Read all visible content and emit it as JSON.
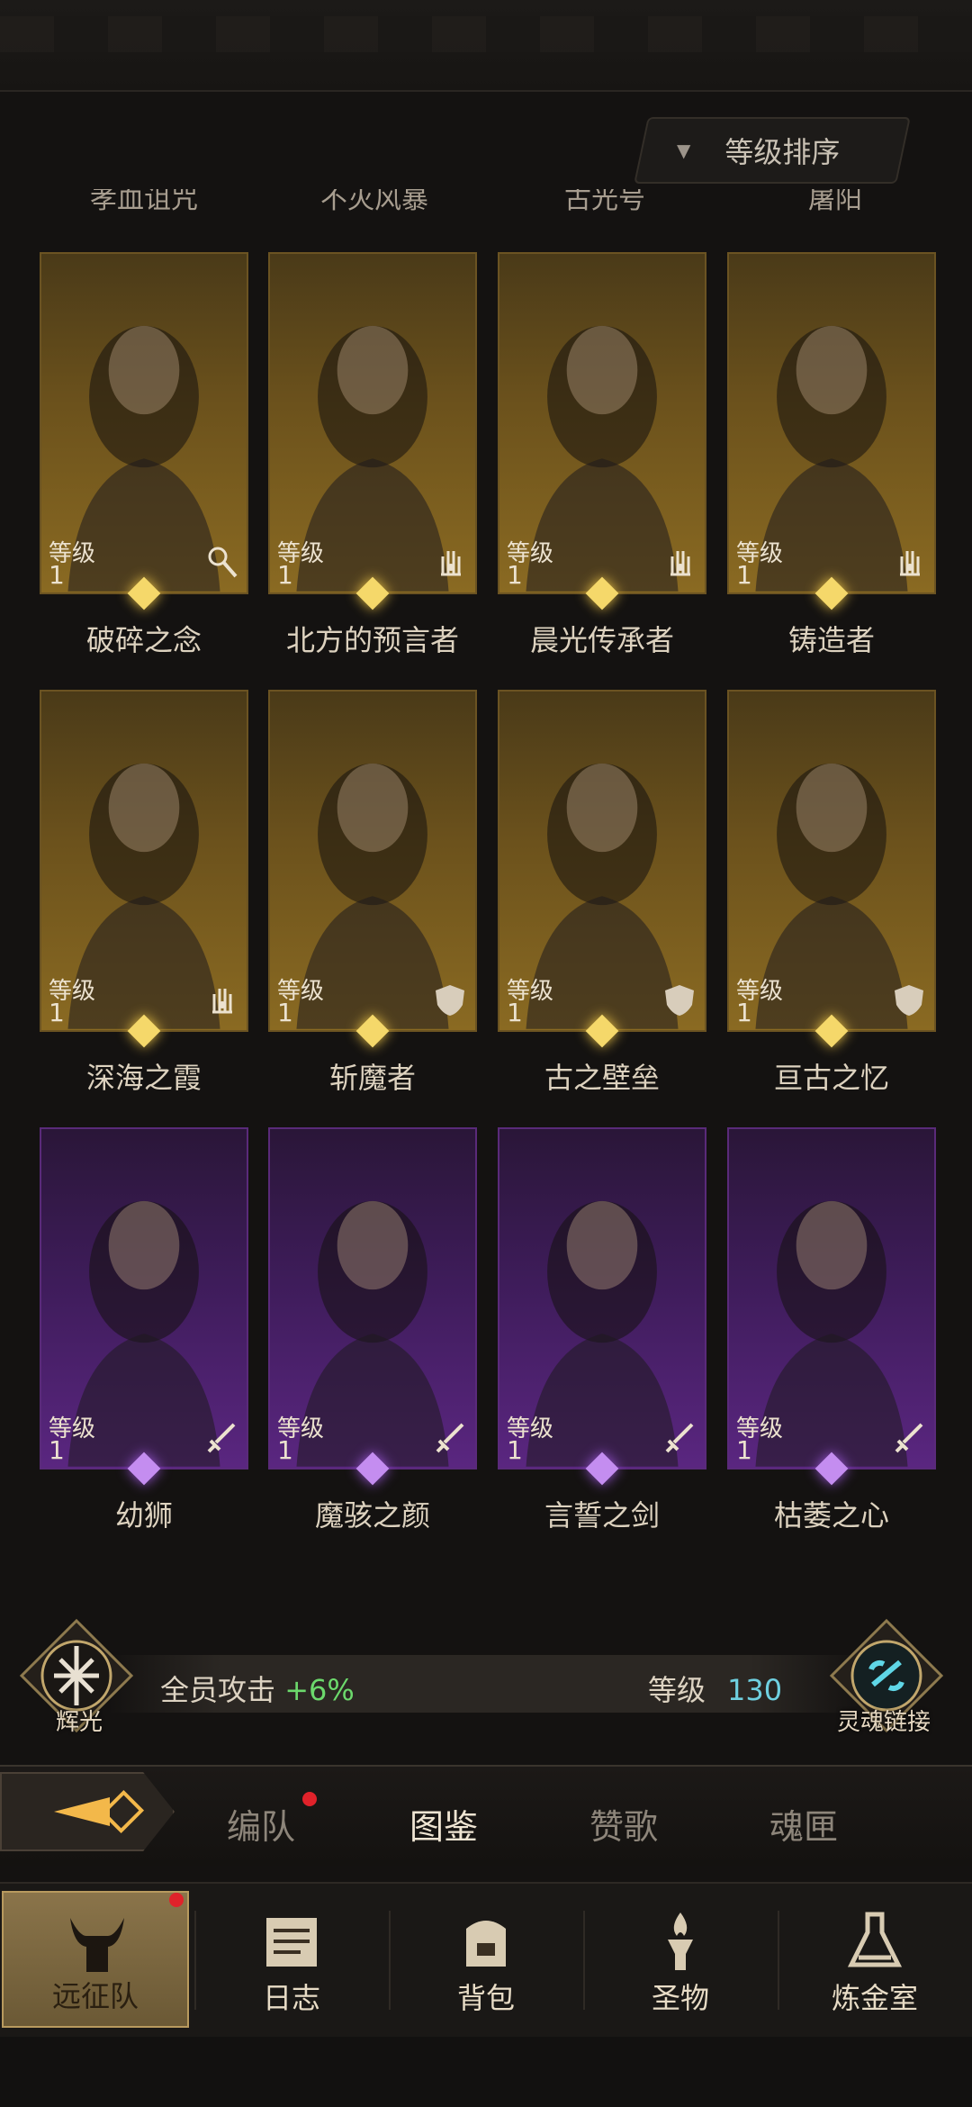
{
  "header": {
    "sort_label": "等级排序"
  },
  "cut_names": [
    "孝血诅咒",
    "不灭风暴",
    "古光号",
    "屠阳"
  ],
  "level_label": "等级",
  "heroes": [
    {
      "name": "破碎之念",
      "level": "1",
      "frame": "gold",
      "class_icon": "staff-icon"
    },
    {
      "name": "北方的预言者",
      "level": "1",
      "frame": "gold",
      "class_icon": "hand-icon"
    },
    {
      "name": "晨光传承者",
      "level": "1",
      "frame": "gold",
      "class_icon": "hand-icon"
    },
    {
      "name": "铸造者",
      "level": "1",
      "frame": "gold",
      "class_icon": "hand-icon"
    },
    {
      "name": "深海之霞",
      "level": "1",
      "frame": "gold",
      "class_icon": "hand-icon"
    },
    {
      "name": "斩魔者",
      "level": "1",
      "frame": "gold",
      "class_icon": "shield-icon"
    },
    {
      "name": "古之壁垒",
      "level": "1",
      "frame": "gold",
      "class_icon": "shield-icon"
    },
    {
      "name": "亘古之忆",
      "level": "1",
      "frame": "gold",
      "class_icon": "shield-icon"
    },
    {
      "name": "幼狮",
      "level": "1",
      "frame": "purple",
      "class_icon": "sword-icon"
    },
    {
      "name": "魔骇之颜",
      "level": "1",
      "frame": "purple",
      "class_icon": "sword-icon"
    },
    {
      "name": "言誓之剑",
      "level": "1",
      "frame": "purple",
      "class_icon": "sword-icon"
    },
    {
      "name": "枯萎之心",
      "level": "1",
      "frame": "purple",
      "class_icon": "sword-icon"
    }
  ],
  "bonus": {
    "left_emblem": "辉光",
    "text": "全员攻击",
    "value": "+6%",
    "level_label": "等级",
    "level_value": "130",
    "right_emblem": "灵魂链接"
  },
  "subtabs": [
    "编队",
    "图鉴",
    "赞歌",
    "魂匣"
  ],
  "subtab_active": "图鉴",
  "bottom_nav": [
    "远征队",
    "日志",
    "背包",
    "圣物",
    "炼金室"
  ],
  "colors": {
    "gold_frame": "#6c521c",
    "purple_frame": "#3e1c5a",
    "bonus_plus": "#6cd96c",
    "level_num": "#6fd0e0",
    "badge": "#e0222a"
  }
}
